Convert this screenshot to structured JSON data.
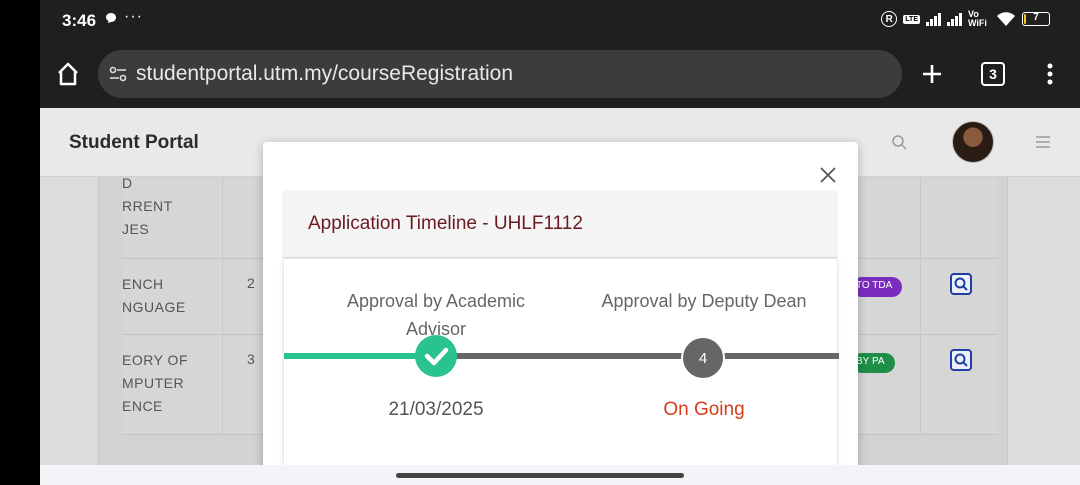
{
  "status_bar": {
    "time": "3:46",
    "dots": "···",
    "lte_label": "LTE",
    "vowifi": "Vo WiFi",
    "battery": "7"
  },
  "browser": {
    "url": "studentportal.utm.my/courseRegistration",
    "tab_count": "3"
  },
  "site": {
    "title": "Student Portal"
  },
  "table": {
    "rows": [
      {
        "name_lines": [
          "D",
          "RRENT",
          "JES"
        ],
        "credit": "",
        "status": ""
      },
      {
        "name_lines": [
          "ENCH",
          "NGUAGE"
        ],
        "credit": "2",
        "status": "TO TDA"
      },
      {
        "name_lines": [
          "EORY OF",
          "MPUTER",
          "ENCE"
        ],
        "credit": "3",
        "status": "BY PA"
      }
    ]
  },
  "modal": {
    "title": "Application Timeline - UHLF1112",
    "steps": [
      {
        "label": "Approval by Academic Advisor",
        "node": "",
        "detail": "21/03/2025",
        "state": "done"
      },
      {
        "label": "Approval by Deputy Dean",
        "node": "4",
        "detail": "On Going",
        "state": "pending"
      }
    ]
  },
  "colors": {
    "done": "#2ac28f",
    "pending": "#666666",
    "ongoing_text": "#d63b1c",
    "title_text": "#6b1a22"
  }
}
